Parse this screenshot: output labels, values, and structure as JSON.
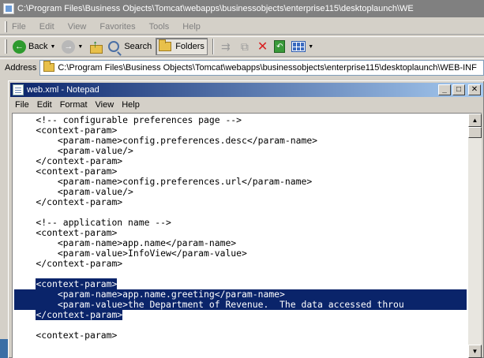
{
  "explorer": {
    "title": "C:\\Program Files\\Business Objects\\Tomcat\\webapps\\businessobjects\\enterprise115\\desktoplaunch\\WE",
    "menu": [
      "File",
      "Edit",
      "View",
      "Favorites",
      "Tools",
      "Help"
    ],
    "toolbar": {
      "back_label": "Back",
      "search_label": "Search",
      "folders_label": "Folders"
    },
    "address": {
      "label": "Address",
      "value": "C:\\Program Files\\Business Objects\\Tomcat\\webapps\\businessobjects\\enterprise115\\desktoplaunch\\WEB-INF"
    }
  },
  "notepad": {
    "title": "web.xml - Notepad",
    "menu": [
      "File",
      "Edit",
      "Format",
      "View",
      "Help"
    ],
    "lines": [
      {
        "text": "    <!-- configurable preferences page -->",
        "sel": false
      },
      {
        "text": "    <context-param>",
        "sel": false
      },
      {
        "text": "        <param-name>config.preferences.desc</param-name>",
        "sel": false
      },
      {
        "text": "        <param-value/>",
        "sel": false
      },
      {
        "text": "    </context-param>",
        "sel": false
      },
      {
        "text": "    <context-param>",
        "sel": false
      },
      {
        "text": "        <param-name>config.preferences.url</param-name>",
        "sel": false
      },
      {
        "text": "        <param-value/>",
        "sel": false
      },
      {
        "text": "    </context-param>",
        "sel": false
      },
      {
        "text": "",
        "sel": false
      },
      {
        "text": "    <!-- application name -->",
        "sel": false
      },
      {
        "text": "    <context-param>",
        "sel": false
      },
      {
        "text": "        <param-name>app.name</param-name>",
        "sel": false
      },
      {
        "text": "        <param-value>InfoView</param-value>",
        "sel": false
      },
      {
        "text": "    </context-param>",
        "sel": false
      },
      {
        "text": "",
        "sel": false
      },
      {
        "text": "<context-param>",
        "sel": true,
        "indent": "    "
      },
      {
        "text": "        <param-name>app.name.greeting</param-name>",
        "sel": true,
        "full": true
      },
      {
        "text": "        <param-value>the Department of Revenue.  The data accessed throu",
        "sel": true,
        "full": true
      },
      {
        "text": "</context-param>",
        "sel": true,
        "indent": "    "
      },
      {
        "text": "",
        "sel": false
      },
      {
        "text": "    <context-param>",
        "sel": false
      }
    ]
  }
}
